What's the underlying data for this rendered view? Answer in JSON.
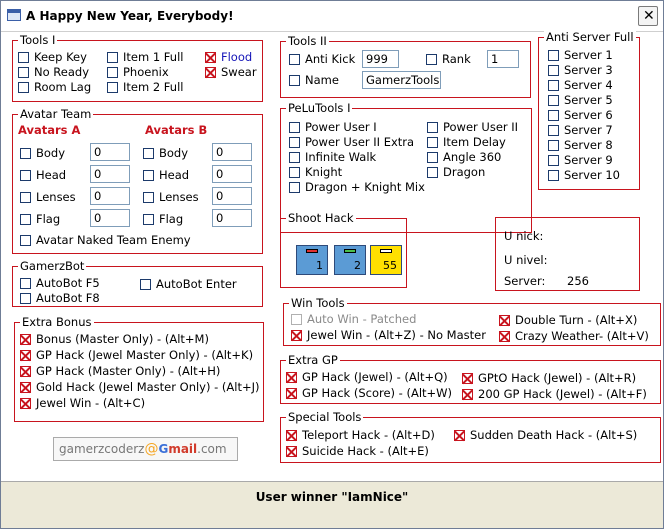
{
  "window": {
    "title": "A Happy New Year, Everybody!",
    "close": "✕"
  },
  "tools1": {
    "title": "Tools I",
    "items": {
      "keep_key": {
        "label": "Keep Key",
        "checked": false
      },
      "no_ready": {
        "label": "No Ready",
        "checked": false
      },
      "room_lag": {
        "label": "Room Lag",
        "checked": false
      },
      "item1_full": {
        "label": "Item 1 Full",
        "checked": false
      },
      "phoenix": {
        "label": "Phoenix",
        "checked": false
      },
      "item2_full": {
        "label": "Item 2 Full",
        "checked": false
      },
      "flood": {
        "label": "Flood",
        "checked": true
      },
      "swear": {
        "label": "Swear",
        "checked": true
      }
    }
  },
  "tools2": {
    "title": "Tools II",
    "anti_kick": {
      "label": "Anti Kick",
      "value": "999"
    },
    "rank": {
      "label": "Rank",
      "value": "1"
    },
    "name": {
      "label": "Name",
      "value": "GamerzTools"
    }
  },
  "anti_server_full": {
    "title": "Anti Server Full",
    "servers": [
      "Server 1",
      "Server 3",
      "Server 4",
      "Server 5",
      "Server 6",
      "Server 7",
      "Server 8",
      "Server 9",
      "Server 10"
    ]
  },
  "avatar_team": {
    "title": "Avatar Team",
    "a_label": "Avatars A",
    "b_label": "Avatars B",
    "rows": [
      {
        "label": "Body",
        "a": "0",
        "b": "0"
      },
      {
        "label": "Head",
        "a": "0",
        "b": "0"
      },
      {
        "label": "Lenses",
        "a": "0",
        "b": "0"
      },
      {
        "label": "Flag",
        "a": "0",
        "b": "0"
      }
    ],
    "naked": "Avatar Naked Team Enemy"
  },
  "pelutools": {
    "title": "PeLuTools I",
    "left": [
      "Power User I",
      "Power User II Extra",
      "Infinite Walk",
      "Knight",
      "Dragon + Knight Mix"
    ],
    "right": [
      "Power User II",
      "Item Delay",
      "Angle 360",
      "Dragon"
    ]
  },
  "shoot_hack": {
    "title": "Shoot Hack",
    "buttons": [
      {
        "num": "1",
        "bg": "#5b9bd5",
        "bar": "#e03030"
      },
      {
        "num": "2",
        "bg": "#5b9bd5",
        "bar": "#4cc04c"
      },
      {
        "num": "55",
        "bg": "#ffe000",
        "bar": "#ffffff"
      }
    ]
  },
  "info": {
    "nick_label": "U nick:",
    "nivel_label": "U nivel:",
    "server_label": "Server:",
    "server_value": "256"
  },
  "gamerzbot": {
    "title": "GamerzBot",
    "f5": "AutoBot F5",
    "f8": "AutoBot F8",
    "enter": "AutoBot Enter"
  },
  "win_tools": {
    "title": "Win Tools",
    "auto_win": "Auto Win - Patched",
    "jewel_win": "Jewel Win - (Alt+Z) - No Master",
    "double_turn": "Double Turn - (Alt+X)",
    "crazy_weather": "Crazy  Weather- (Alt+V)"
  },
  "extra_bonus": {
    "title": "Extra Bonus",
    "items": [
      "Bonus (Master Only) - (Alt+M)",
      "GP Hack (Jewel Master Only) - (Alt+K)",
      "GP Hack (Master Only) - (Alt+H)",
      "Gold Hack (Jewel Master Only) - (Alt+J)",
      "Jewel Win - (Alt+C)"
    ]
  },
  "extra_gp": {
    "title": "Extra GP",
    "gp_jewel": "GP Hack (Jewel) - (Alt+Q)",
    "gp_score": "GP Hack (Score) - (Alt+W)",
    "gpto": "GPtO Hack (Jewel) - (Alt+R)",
    "gp200": "200 GP Hack (Jewel) - (Alt+F)"
  },
  "special_tools": {
    "title": "Special Tools",
    "teleport": "Teleport Hack - (Alt+D)",
    "suicide": "Suicide Hack - (Alt+E)",
    "sudden_death": "Sudden Death Hack - (Alt+S)"
  },
  "email": {
    "user": "gamerzcoderz",
    "at": "@",
    "g": "G",
    "mail": "mail",
    "domain": ".com"
  },
  "footer": {
    "status": "User winner \"IamNice\""
  }
}
